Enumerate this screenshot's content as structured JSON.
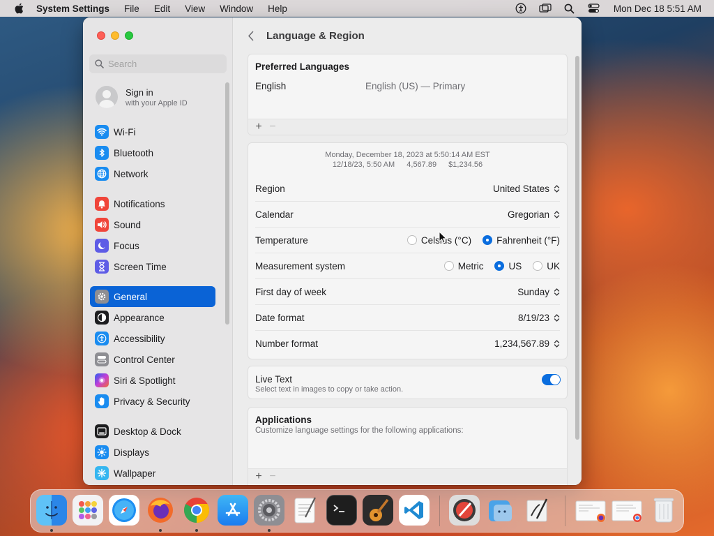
{
  "menubar": {
    "app_name": "System Settings",
    "items": [
      "File",
      "Edit",
      "View",
      "Window",
      "Help"
    ],
    "clock": "Mon Dec 18  5:51 AM"
  },
  "sidebar": {
    "search_placeholder": "Search",
    "signin": {
      "title": "Sign in",
      "subtitle": "with your Apple ID"
    },
    "items": [
      {
        "label": "Wi-Fi",
        "icon": "wifi-icon",
        "color": "#1a8cf0"
      },
      {
        "label": "Bluetooth",
        "icon": "bluetooth-icon",
        "color": "#1a8cf0"
      },
      {
        "label": "Network",
        "icon": "globe-icon",
        "color": "#1a8cf0"
      },
      {
        "label": "Notifications",
        "icon": "bell-icon",
        "color": "#f0453a"
      },
      {
        "label": "Sound",
        "icon": "speaker-icon",
        "color": "#f0453a"
      },
      {
        "label": "Focus",
        "icon": "moon-icon",
        "color": "#5e5ce6"
      },
      {
        "label": "Screen Time",
        "icon": "hourglass-icon",
        "color": "#5e5ce6"
      },
      {
        "label": "General",
        "icon": "gear-icon",
        "color": "#8e8e93",
        "selected": true
      },
      {
        "label": "Appearance",
        "icon": "appearance-icon",
        "color": "#1d1d1f"
      },
      {
        "label": "Accessibility",
        "icon": "accessibility-icon",
        "color": "#1a8cf0"
      },
      {
        "label": "Control Center",
        "icon": "control-center-icon",
        "color": "#8e8e93"
      },
      {
        "label": "Siri & Spotlight",
        "icon": "siri-icon",
        "color": "#7d3ce8"
      },
      {
        "label": "Privacy & Security",
        "icon": "hand-icon",
        "color": "#1a8cf0"
      },
      {
        "label": "Desktop & Dock",
        "icon": "dock-icon",
        "color": "#1d1d1f"
      },
      {
        "label": "Displays",
        "icon": "sun-icon",
        "color": "#1a8cf0"
      },
      {
        "label": "Wallpaper",
        "icon": "wallpaper-icon",
        "color": "#35b6f0"
      }
    ]
  },
  "content": {
    "title": "Language & Region",
    "preferred": {
      "heading": "Preferred Languages",
      "language": "English",
      "language_detail": "English (US) — Primary",
      "add": "+",
      "remove": "−"
    },
    "preview": {
      "line1": "Monday, December 18, 2023 at 5:50:14 AM EST",
      "date_short": "12/18/23, 5:50 AM",
      "number": "4,567.89",
      "currency": "$1,234.56"
    },
    "rows": {
      "region": {
        "label": "Region",
        "value": "United States"
      },
      "calendar": {
        "label": "Calendar",
        "value": "Gregorian"
      },
      "temperature": {
        "label": "Temperature",
        "options": [
          "Celsius (°C)",
          "Fahrenheit (°F)"
        ],
        "selected": "Fahrenheit (°F)"
      },
      "measurement": {
        "label": "Measurement system",
        "options": [
          "Metric",
          "US",
          "UK"
        ],
        "selected": "US"
      },
      "first_day": {
        "label": "First day of week",
        "value": "Sunday"
      },
      "date_format": {
        "label": "Date format",
        "value": "8/19/23"
      },
      "number_format": {
        "label": "Number format",
        "value": "1,234,567.89"
      }
    },
    "live_text": {
      "title": "Live Text",
      "subtitle": "Select text in images to copy or take action.",
      "enabled": true
    },
    "applications": {
      "title": "Applications",
      "subtitle": "Customize language settings for the following applications:",
      "add": "+",
      "remove": "−"
    }
  },
  "dock": {
    "apps": [
      {
        "name": "finder-icon",
        "running": true
      },
      {
        "name": "launchpad-icon",
        "running": false
      },
      {
        "name": "safari-icon",
        "running": false
      },
      {
        "name": "firefox-icon",
        "running": true
      },
      {
        "name": "chrome-icon",
        "running": true
      },
      {
        "name": "app-store-icon",
        "running": false
      },
      {
        "name": "system-settings-icon",
        "running": true
      },
      {
        "name": "textedit-icon",
        "running": false
      },
      {
        "name": "terminal-icon",
        "running": false
      },
      {
        "name": "garageband-icon",
        "running": false
      },
      {
        "name": "vscode-icon",
        "running": false
      },
      {
        "name": "script-editor-icon",
        "running": false
      },
      {
        "name": "migration-assistant-icon",
        "running": false
      },
      {
        "name": "preview-icon",
        "running": false
      },
      {
        "name": "recent-window-firefox-icon",
        "running": false
      },
      {
        "name": "recent-window-chrome-icon",
        "running": false
      },
      {
        "name": "trash-icon",
        "running": false
      }
    ]
  }
}
